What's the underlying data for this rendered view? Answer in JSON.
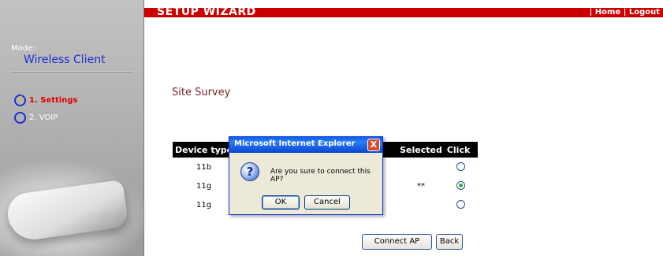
{
  "header": {
    "title": "SETUP WIZARD",
    "links": [
      "| Home",
      "| Logout"
    ]
  },
  "sidebar": {
    "mode_label": "Mode:",
    "mode_value": "Wireless Client",
    "steps": [
      {
        "label": "1. Settings",
        "active": true
      },
      {
        "label": "2. VOIP",
        "active": false
      }
    ]
  },
  "main": {
    "title": "Site Survey",
    "table": {
      "columns": [
        "Device type",
        "Selected",
        "Click"
      ],
      "rows": [
        {
          "device_type": "11b",
          "selected": "",
          "checked": false
        },
        {
          "device_type": "11g",
          "selected": "**",
          "checked": true
        },
        {
          "device_type": "11g",
          "selected": "",
          "checked": false
        }
      ]
    },
    "buttons": {
      "connect": "Connect AP",
      "back": "Back"
    }
  },
  "dialog": {
    "title": "Microsoft Internet Explorer",
    "close_label": "X",
    "icon": "question-icon",
    "message": "Are you sure to connect this AP?",
    "ok": "OK",
    "cancel": "Cancel"
  },
  "colors": {
    "header_red": "#cc0000",
    "dialog_title_blue": "#0a5fe8",
    "mode_value_blue": "#1a2fd4",
    "active_step_red": "#e00000"
  }
}
